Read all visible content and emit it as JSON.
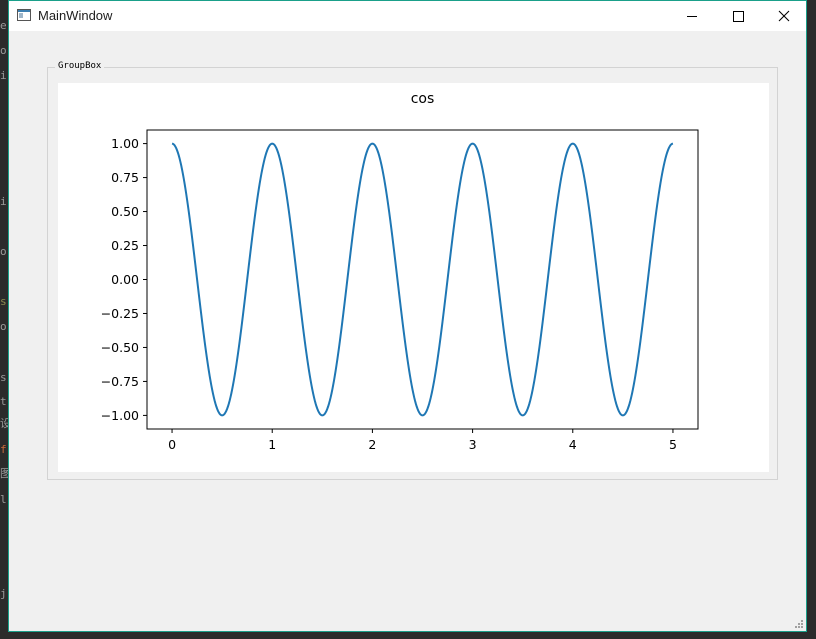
{
  "window": {
    "title": "MainWindow",
    "minimize_icon": "minimize-icon",
    "maximize_icon": "maximize-icon",
    "close_icon": "close-icon"
  },
  "background_glyphs": [
    "e",
    "o",
    "i",
    "i",
    "o",
    "s",
    "o",
    "s",
    "t",
    "设",
    "f",
    "图",
    "l",
    "j"
  ],
  "groupbox": {
    "title": "GroupBox"
  },
  "chart_data": {
    "type": "line",
    "title": "cos",
    "xlabel": "",
    "ylabel": "",
    "xlim": [
      -0.25,
      5.25
    ],
    "ylim": [
      -1.1,
      1.1
    ],
    "xticks": [
      "0",
      "1",
      "2",
      "3",
      "4",
      "5"
    ],
    "yticks": [
      "1.00",
      "0.75",
      "0.50",
      "0.25",
      "0.00",
      "−0.25",
      "−0.50",
      "−0.75",
      "−1.00"
    ],
    "grid": false,
    "legend": "none",
    "series": [
      {
        "function": "y = cos(2πx)",
        "x": [
          0,
          0.25,
          0.5,
          0.75,
          1,
          1.25,
          1.5,
          1.75,
          2,
          2.25,
          2.5,
          2.75,
          3,
          3.25,
          3.5,
          3.75,
          4,
          4.25,
          4.5,
          4.75,
          5
        ],
        "y": [
          1,
          0,
          -1,
          0,
          1,
          0,
          -1,
          0,
          1,
          0,
          -1,
          0,
          1,
          0,
          -1,
          0,
          1,
          0,
          -1,
          0,
          1
        ],
        "color": "#1f77b4"
      }
    ]
  },
  "colors": {
    "line": "#1f77b4",
    "window_bg": "#f0f0f0",
    "accent_border": "#1aa08a"
  }
}
